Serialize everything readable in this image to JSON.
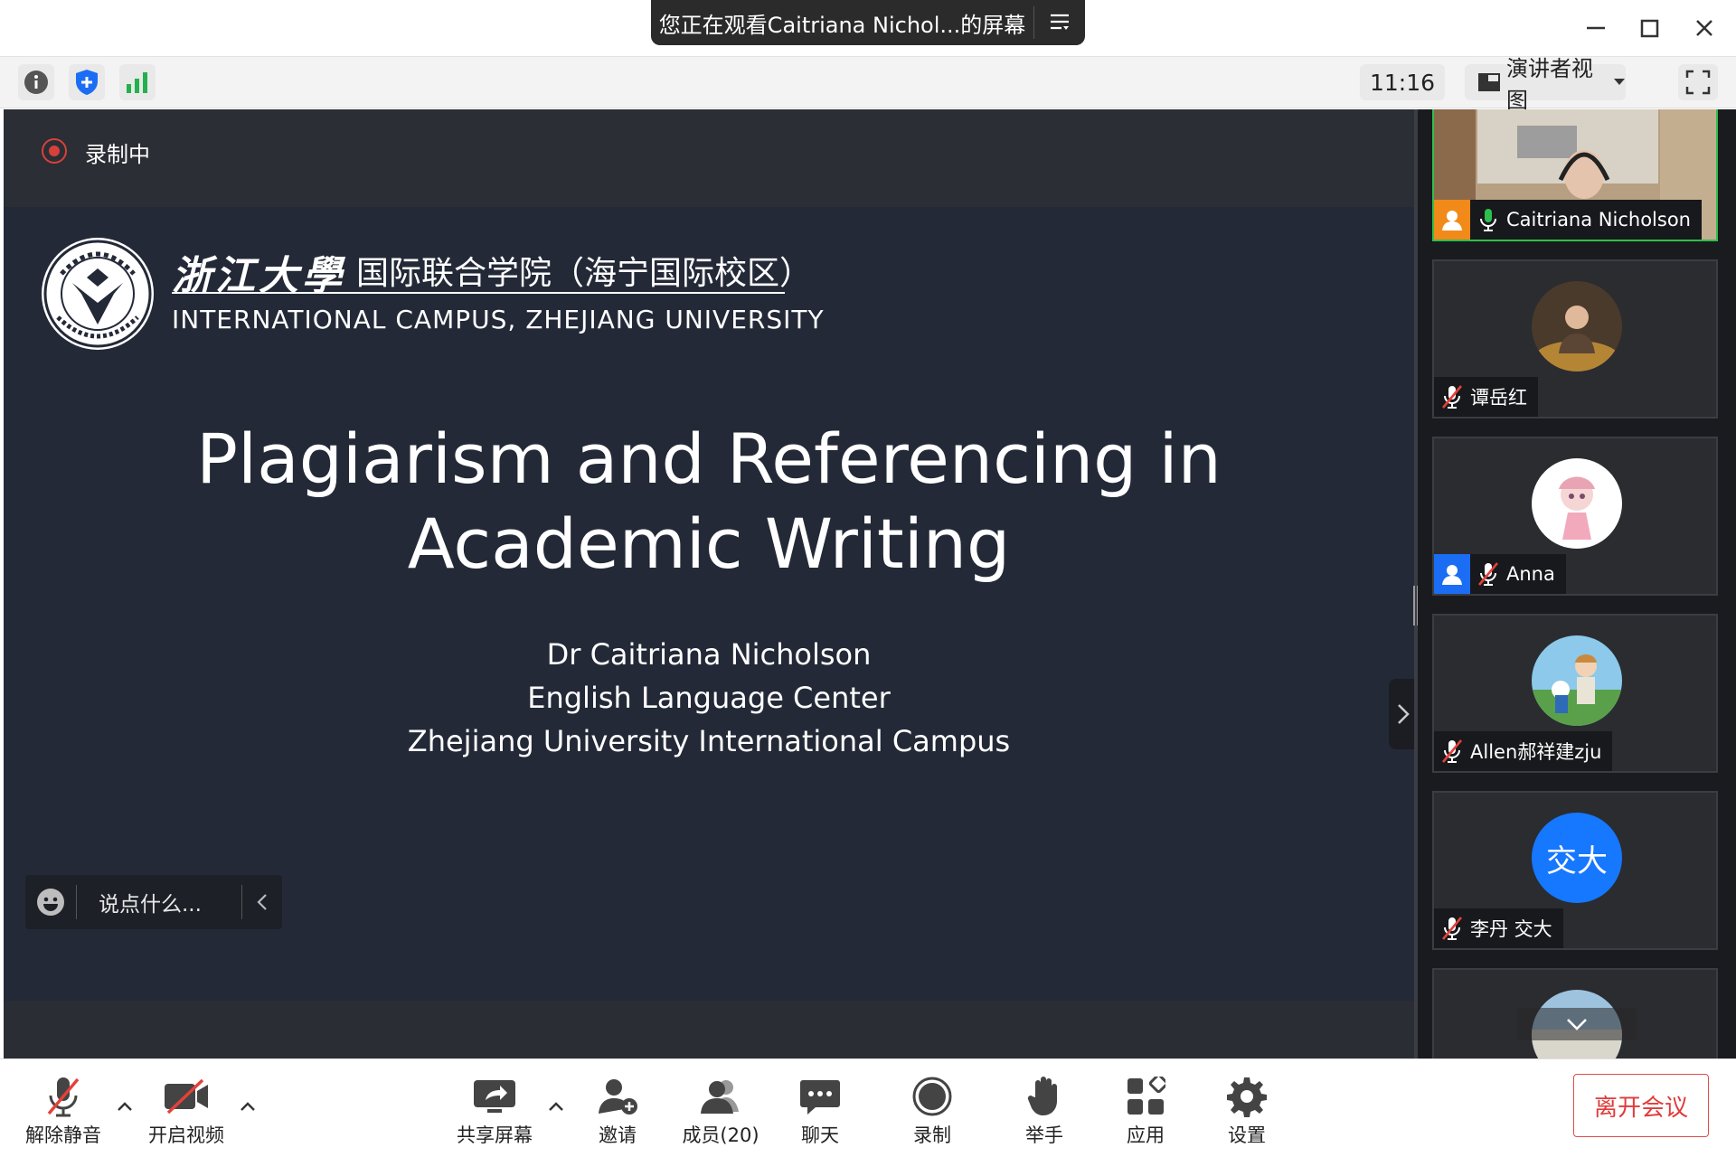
{
  "titlebar": {
    "share_notice": "您正在观看Caitriana Nichol...的屏幕"
  },
  "toolbar": {
    "info_icon": "info-icon",
    "security_icon": "shield-plus-icon",
    "signal_icon": "signal-bars-icon",
    "clock": "11:16",
    "view_mode": "演讲者视图"
  },
  "recording": {
    "label": "录制中"
  },
  "slide": {
    "logo_cn_university": "浙江大學",
    "logo_cn_college": "国际联合学院（海宁国际校区）",
    "logo_en": "INTERNATIONAL CAMPUS, ZHEJIANG UNIVERSITY",
    "title_line1": "Plagiarism and Referencing in",
    "title_line2": "Academic Writing",
    "author": "Dr Caitriana Nicholson",
    "department": "English Language Center",
    "institution": "Zhejiang University International Campus"
  },
  "chat_bar": {
    "placeholder": "说点什么..."
  },
  "participants": [
    {
      "name": "Caitriana Nicholson",
      "mic": "on",
      "role": "host",
      "video": true
    },
    {
      "name": "谭岳红",
      "mic": "muted",
      "role": "",
      "video": false
    },
    {
      "name": "Anna",
      "mic": "muted",
      "role": "cohost",
      "video": false
    },
    {
      "name": "Allen郝祥建zju",
      "mic": "muted",
      "role": "",
      "video": false
    },
    {
      "name": "李丹 交大",
      "mic": "muted",
      "role": "",
      "video": false,
      "avatar_text": "交大"
    }
  ],
  "bottombar": {
    "unmute": "解除静音",
    "start_video": "开启视频",
    "share_screen": "共享屏幕",
    "invite": "邀请",
    "members": "成员(20)",
    "chat": "聊天",
    "record": "录制",
    "raise_hand": "举手",
    "apps": "应用",
    "settings": "设置",
    "leave": "离开会议"
  },
  "colors": {
    "slide_bg": "#232937",
    "active_border": "#2fbf4d",
    "leave": "#e03b3b",
    "host_badge": "#f28a1a",
    "cohost_badge": "#1b6ef3",
    "avatar_blue": "#1677ff"
  }
}
